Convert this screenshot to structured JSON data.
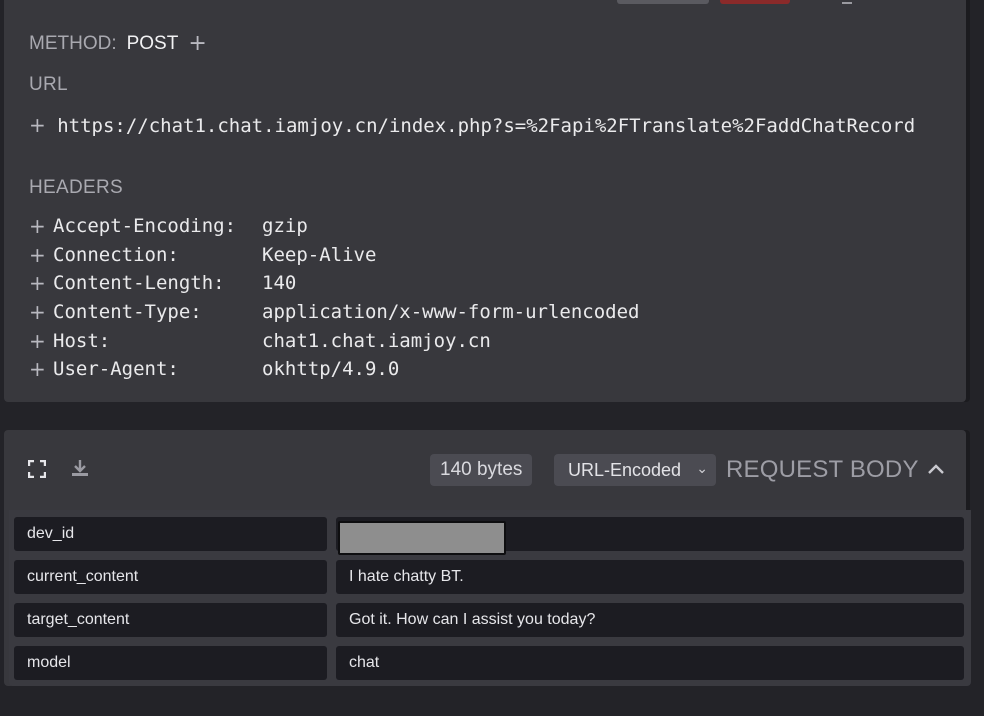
{
  "request": {
    "method_label": "METHOD:",
    "method": "POST",
    "url_label": "URL",
    "url": "https://chat1.chat.iamjoy.cn/index.php?s=%2Fapi%2FTranslate%2FaddChatRecord",
    "headers_label": "HEADERS",
    "headers": [
      {
        "name": "Accept-Encoding:",
        "value": "gzip"
      },
      {
        "name": "Connection:",
        "value": "Keep-Alive"
      },
      {
        "name": "Content-Length:",
        "value": "140"
      },
      {
        "name": "Content-Type:",
        "value": "application/x-www-form-urlencoded"
      },
      {
        "name": "Host:",
        "value": "chat1.chat.iamjoy.cn"
      },
      {
        "name": "User-Agent:",
        "value": "okhttp/4.9.0"
      }
    ]
  },
  "body": {
    "size": "140 bytes",
    "encoding": "URL-Encoded",
    "title": "REQUEST BODY",
    "rows": [
      {
        "key": "dev_id",
        "value": ""
      },
      {
        "key": "current_content",
        "value": "I hate chatty BT."
      },
      {
        "key": "target_content",
        "value": "Got it. How can I assist you today?"
      },
      {
        "key": "model",
        "value": "chat"
      }
    ]
  },
  "icons": {
    "plus": "+",
    "chevron_down": "⌄",
    "fullscreen": "fullscreen-icon",
    "download": "download-icon",
    "collapse": "chevron-up-icon"
  },
  "colors": {
    "background": "#232328",
    "panel": "#38383d",
    "cell": "#1c1c22",
    "redaction": "#8e8e8e"
  }
}
